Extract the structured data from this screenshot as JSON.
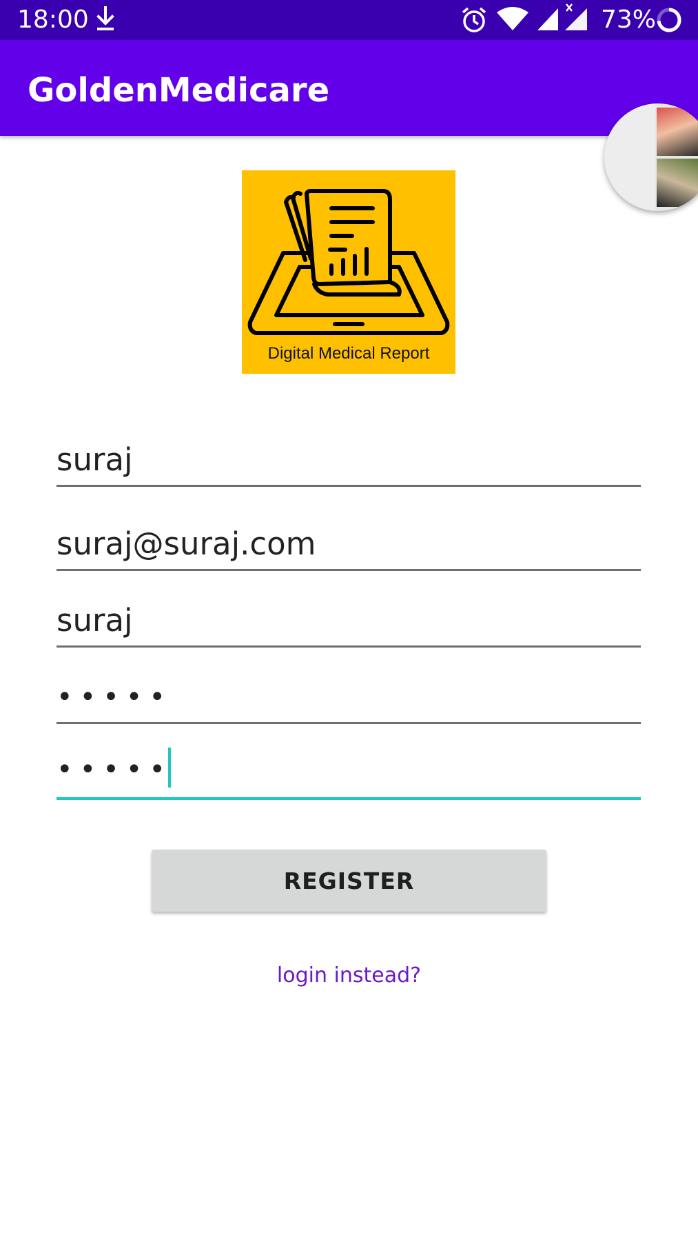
{
  "status_bar": {
    "time": "18:00",
    "battery_percent": "73%",
    "icons": [
      "download-icon",
      "alarm-icon",
      "wifi-icon",
      "signal-icon",
      "signal-no-data-icon",
      "battery-icon"
    ],
    "background": "#3a00b0"
  },
  "app_bar": {
    "title": "GoldenMedicare",
    "background": "#6200ea"
  },
  "logo": {
    "caption": "Digital Medical Report",
    "background": "#ffc000"
  },
  "form": {
    "fields": [
      {
        "value": "suraj",
        "type": "text"
      },
      {
        "value": "suraj@suraj.com",
        "type": "email"
      },
      {
        "value": "suraj",
        "type": "text"
      },
      {
        "value": "•••••",
        "type": "password"
      },
      {
        "value": "•••••",
        "type": "password",
        "focused": true
      }
    ],
    "accent_color": "#1ec9bb",
    "register_label": "REGISTER",
    "login_link": "login instead?"
  }
}
